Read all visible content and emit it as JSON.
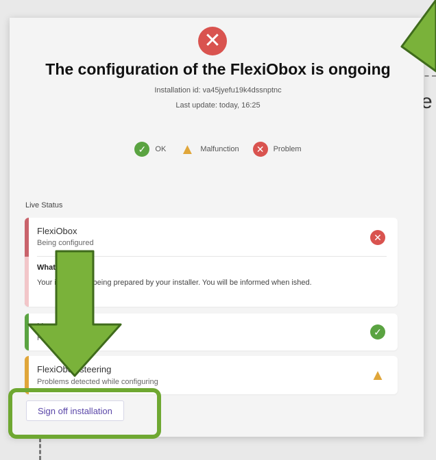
{
  "header": {
    "title": "The configuration of the FlexiObox is ongoing",
    "installation_id": "Installation id: va45jyefu19k4dssnptnc",
    "last_update": "Last update: today, 16:25"
  },
  "legend": {
    "ok": "OK",
    "malfunction": "Malfunction",
    "problem": "Problem"
  },
  "live_status_label": "Live Status",
  "cards": [
    {
      "title": "FlexiObox",
      "subtitle": "Being configured",
      "status": "problem",
      "detail_title": "What",
      "detail_body": "Your         is currently being prepared by your installer. You will be informed when      ished."
    },
    {
      "title": "User          ation",
      "subtitle": "F",
      "status": "ok"
    },
    {
      "title": "FlexiObox steering",
      "subtitle": "Problems detected while configuring",
      "status": "malfunction"
    }
  ],
  "signoff_button": "Sign off installation",
  "background_fragment": "e",
  "colors": {
    "ok": "#5aa341",
    "problem": "#d9534f",
    "malfunction": "#e0a63a",
    "highlight": "#6fa832",
    "link": "#5a46a8"
  }
}
